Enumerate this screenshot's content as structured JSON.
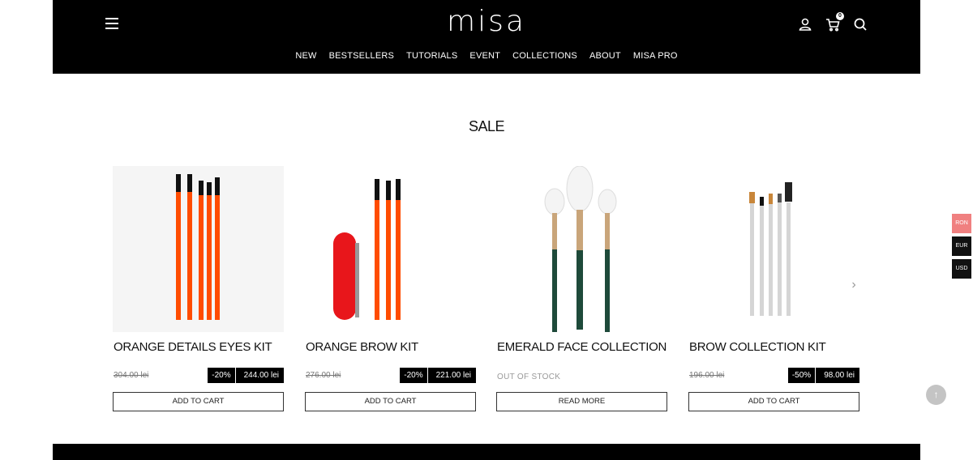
{
  "header": {
    "logo": "misa",
    "cart_count": "0",
    "nav": [
      "NEW",
      "BESTSELLERS",
      "TUTORIALS",
      "EVENT",
      "COLLECTIONS",
      "ABOUT",
      "MISA PRO"
    ]
  },
  "section": {
    "title": "SALE"
  },
  "products": [
    {
      "name": "ORANGE DETAILS EYES KIT",
      "old_price": "304.00 lei",
      "discount": "-20%",
      "price": "244.00 lei",
      "button": "ADD TO CART"
    },
    {
      "name": "ORANGE BROW KIT",
      "old_price": "276.00 lei",
      "discount": "-20%",
      "price": "221.00 lei",
      "button": "ADD TO CART"
    },
    {
      "name": "EMERALD FACE COLLECTION",
      "status": "OUT OF STOCK",
      "button": "READ MORE"
    },
    {
      "name": "BROW COLLECTION KIT",
      "old_price": "196.00 lei",
      "discount": "-50%",
      "price": "98.00 lei",
      "button": "ADD TO CART"
    }
  ],
  "currency": [
    "RON",
    "EUR",
    "USD"
  ],
  "colors": {
    "header_bg": "#000000",
    "accent_currency": "#f08080",
    "brush_orange": "#ff4c00",
    "brush_green": "#1e4a3a"
  },
  "icons": {
    "menu": "hamburger-icon",
    "user": "user-icon",
    "cart": "cart-icon",
    "search": "search-icon",
    "prev": "chevron-left-icon",
    "next": "chevron-right-icon",
    "top": "arrow-up-icon"
  }
}
